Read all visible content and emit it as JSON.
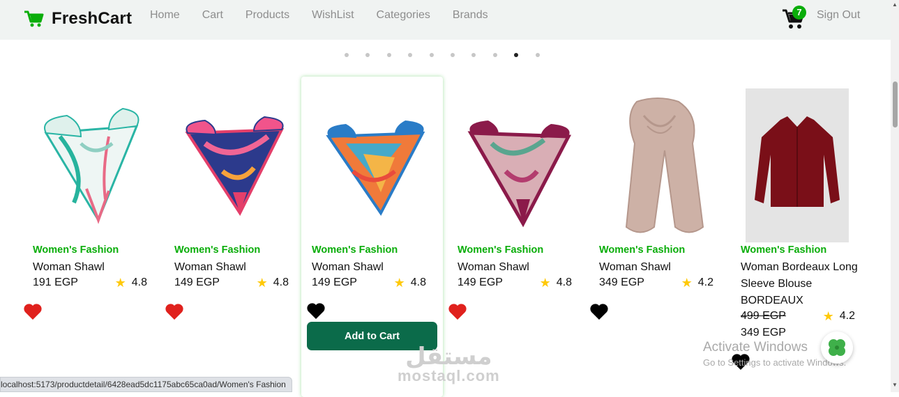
{
  "brand": {
    "name": "FreshCart"
  },
  "nav": {
    "links": [
      "Home",
      "Cart",
      "Products",
      "WishList",
      "Categories",
      "Brands"
    ],
    "cart_count": "7",
    "signout": "Sign Out"
  },
  "carousel": {
    "total_dots": 10,
    "active_dot": 9
  },
  "products": [
    {
      "category": "Women's Fashion",
      "title": "Woman Shawl",
      "price": "191 EGP",
      "rating": "4.8",
      "wishlisted": true
    },
    {
      "category": "Women's Fashion",
      "title": "Woman Shawl",
      "price": "149 EGP",
      "rating": "4.8",
      "wishlisted": true
    },
    {
      "category": "Women's Fashion",
      "title": "Woman Shawl",
      "price": "149 EGP",
      "rating": "4.8",
      "wishlisted": false,
      "add_to_cart": "Add to Cart"
    },
    {
      "category": "Women's Fashion",
      "title": "Woman Shawl",
      "price": "149 EGP",
      "rating": "4.8",
      "wishlisted": true
    },
    {
      "category": "Women's Fashion",
      "title": "Woman Shawl",
      "price": "349 EGP",
      "rating": "4.2",
      "wishlisted": false
    },
    {
      "category": "Women's Fashion",
      "title": "Woman Bordeaux Long Sleeve Blouse BORDEAUX",
      "old_price": "499 EGP",
      "price": "349 EGP",
      "rating": "4.2",
      "wishlisted": false
    }
  ],
  "colors": {
    "accent": "#0aad0a",
    "button": "#0b6b4a",
    "heart_red": "#e0211d",
    "star": "#ffc908"
  },
  "status_bar": {
    "url": "localhost:5173/productdetail/6428ead5dc1175abc65ca0ad/Women's Fashion"
  },
  "watermark": {
    "title": "Activate Windows",
    "subtitle": "Go to Settings to activate Windows."
  },
  "overlay": {
    "arabic": "مستقل",
    "latin": "mostaql.com"
  }
}
